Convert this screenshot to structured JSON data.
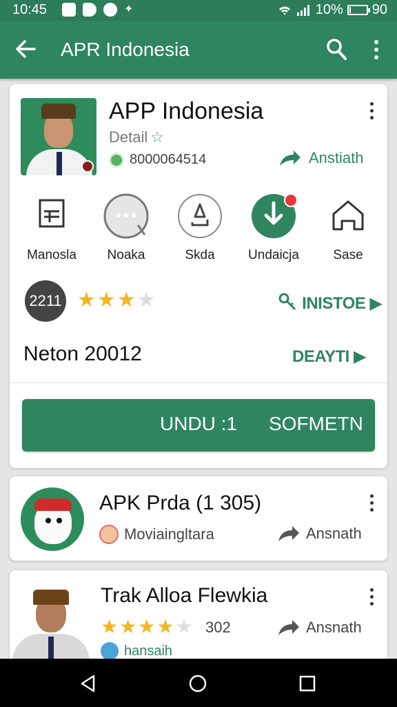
{
  "status": {
    "time": "10:45",
    "battery_percent": "10%",
    "battery_level": 0.1,
    "extra": "90",
    "icons": [
      "notification-icon",
      "message-icon",
      "sync-icon",
      "star-icon"
    ]
  },
  "appbar": {
    "title": "APR Indonesia"
  },
  "main_app": {
    "title": "APP Indonesia",
    "subtitle": "Detail",
    "subtitle_icon": "☆",
    "id": "8000064514",
    "right_action": "Anstiath",
    "actions": [
      {
        "label": "Manosla",
        "icon": "form-icon"
      },
      {
        "label": "Noaka",
        "icon": "chat-icon"
      },
      {
        "label": "Skda",
        "icon": "share-icon"
      },
      {
        "label": "Undaicja",
        "icon": "download-icon"
      },
      {
        "label": "Sase",
        "icon": "home-icon"
      }
    ],
    "rating_badge": "2211",
    "rating_stars": 3,
    "rating_max": 4,
    "install_link": "INISTOE",
    "version": "Neton 20012",
    "detail_link": "DEAYTI",
    "cta_left": "UNDU :1",
    "cta_right": "SOFMETN"
  },
  "list": [
    {
      "title": "APK Prda (1 305)",
      "subtitle": "Moviaingltara",
      "action": "Ansnath"
    },
    {
      "title": "Trak Alloa Flewkia",
      "rating_stars": 4,
      "rating_max": 5,
      "rating_count": "302",
      "action": "Ansnath",
      "footer": "hansaih"
    }
  ]
}
